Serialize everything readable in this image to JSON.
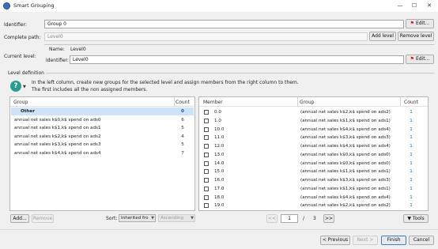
{
  "window": {
    "title": "Smart Grouping",
    "minimize": "—",
    "maximize": "☐",
    "close": "✕"
  },
  "identifier": {
    "label": "Identifier:",
    "value": "Group 0",
    "edit": "Edit..."
  },
  "complete_path": {
    "label": "Complete path:",
    "value": "Level0",
    "add_level": "Add level",
    "remove_level": "Remove level"
  },
  "current_level": {
    "label": "Current level:",
    "name_label": "Name:",
    "name_value": "Level0",
    "identifier_label": "Identifier:",
    "identifier_value": "Level0",
    "edit": "Edit..."
  },
  "level_definition": {
    "title": "Level definition",
    "help_line1": "In the left column, create new groups for the selected level and assign members from the right column to them.",
    "help_line2": "The first includes all the non assigned members."
  },
  "groups": {
    "headers": {
      "group": "Group",
      "count": "Count"
    },
    "rows": [
      {
        "name": "Other",
        "count": "0"
      },
      {
        "name": "annual net sales k$0,k$ spend on ads0",
        "count": "6"
      },
      {
        "name": "annual net sales k$1,k$ spend on ads1",
        "count": "5"
      },
      {
        "name": "annual net sales k$2,k$ spend on ads2",
        "count": "4"
      },
      {
        "name": "annual net sales k$3,k$ spend on ads3",
        "count": "5"
      },
      {
        "name": "annual net sales k$4,k$ spend on ads4",
        "count": "7"
      }
    ]
  },
  "members": {
    "headers": {
      "member": "Member",
      "group": "Group",
      "count": "Count"
    },
    "rows": [
      {
        "member": "0.0",
        "group": "(annual net sales k$2,k$ spend on ads2)",
        "count": "1"
      },
      {
        "member": "1.0",
        "group": "(annual net sales k$1,k$ spend on ads1)",
        "count": "1"
      },
      {
        "member": "10.0",
        "group": "(annual net sales k$4,k$ spend on ads4)",
        "count": "1"
      },
      {
        "member": "11.0",
        "group": "(annual net sales k$3,k$ spend on ads3)",
        "count": "1"
      },
      {
        "member": "12.0",
        "group": "(annual net sales k$4,k$ spend on ads4)",
        "count": "1"
      },
      {
        "member": "13.0",
        "group": "(annual net sales k$0,k$ spend on ads0)",
        "count": "1"
      },
      {
        "member": "14.0",
        "group": "(annual net sales k$0,k$ spend on ads0)",
        "count": "1"
      },
      {
        "member": "15.0",
        "group": "(annual net sales k$1,k$ spend on ads1)",
        "count": "1"
      },
      {
        "member": "16.0",
        "group": "(annual net sales k$3,k$ spend on ads3)",
        "count": "1"
      },
      {
        "member": "17.0",
        "group": "(annual net sales k$1,k$ spend on ads1)",
        "count": "1"
      },
      {
        "member": "18.0",
        "group": "(annual net sales k$4,k$ spend on ads4)",
        "count": "1"
      },
      {
        "member": "19.0",
        "group": "(annual net sales k$2,k$ spend on ads2)",
        "count": "1"
      }
    ]
  },
  "bottom_bar": {
    "add": "Add...",
    "remove": "Remove",
    "sort_label": "Sort:",
    "sort_value": "Inherited fro",
    "order_value": "Ascending",
    "first_page": "<<",
    "page_value": "1",
    "page_sep": "/",
    "page_total": "3",
    "last_page": ">>",
    "tools": "▼ Tools"
  },
  "footer": {
    "previous": "< Previous",
    "next": "Next >",
    "finish": "Finish",
    "cancel": "Cancel"
  },
  "colors": {
    "selected_count": "#1a4f9c",
    "count": "#1a6fb0",
    "help_icon": "#2a9d8f"
  }
}
